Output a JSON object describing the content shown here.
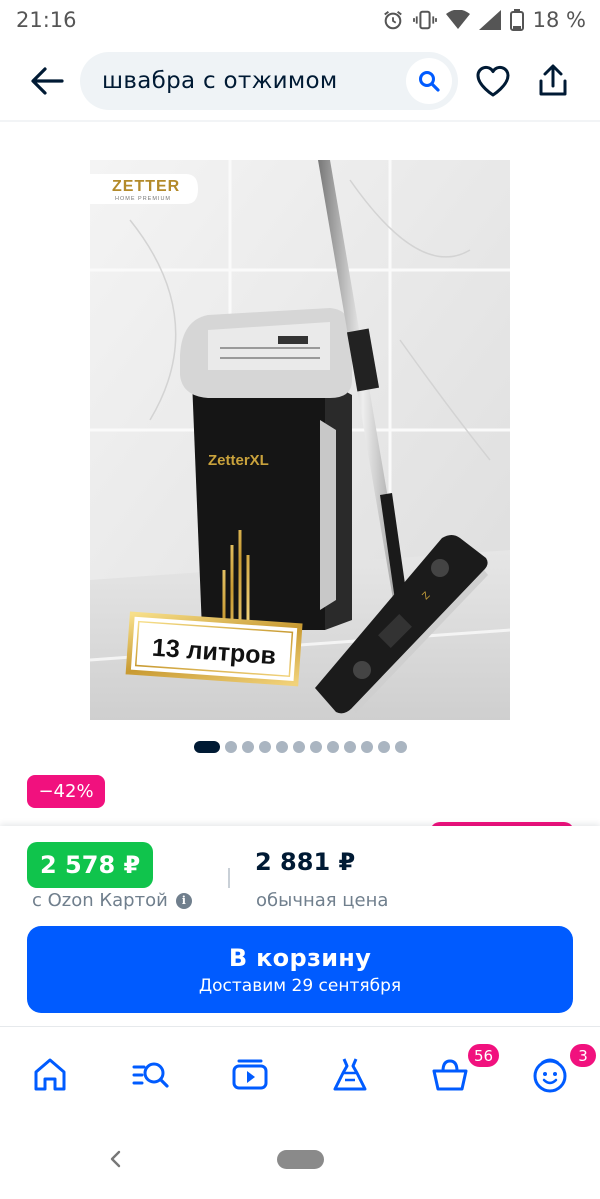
{
  "status_bar": {
    "time": "21:16",
    "battery": "18 %",
    "icons": [
      "alarm-icon",
      "vibrate-icon",
      "wifi-icon",
      "signal-icon",
      "battery-icon"
    ]
  },
  "header": {
    "search_query": "швабра с отжимом",
    "icons": [
      "back-arrow-icon",
      "search-icon",
      "heart-icon",
      "share-icon"
    ]
  },
  "product": {
    "image_brand": "ZETTER",
    "image_brand_sub": "HOME PREMIUM",
    "image_bucket_label": "ZetterXL",
    "image_mop_label": "Z",
    "image_badge": "13 литров",
    "gallery": {
      "total": 12,
      "active": 1
    },
    "discount": "−42%"
  },
  "price": {
    "ozon_price": "2 578 ₽",
    "ozon_caption": "с Ozon Картой",
    "regular_price": "2 881 ₽",
    "regular_caption": "обычная цена"
  },
  "cart_button": {
    "title": "В корзину",
    "subtitle": "Доставим 29 сентября"
  },
  "bottom_nav": {
    "items": [
      "home-icon",
      "catalog-search-icon",
      "video-icon",
      "fashion-dress-icon",
      "cart-basket-icon",
      "profile-face-icon"
    ],
    "cart_badge": "56",
    "profile_badge": "3"
  },
  "colors": {
    "brand_blue": "#005bff",
    "price_green": "#10c44c",
    "discount_pink": "#f1117e",
    "text_dark": "#001a34",
    "text_muted": "#707f8d"
  }
}
